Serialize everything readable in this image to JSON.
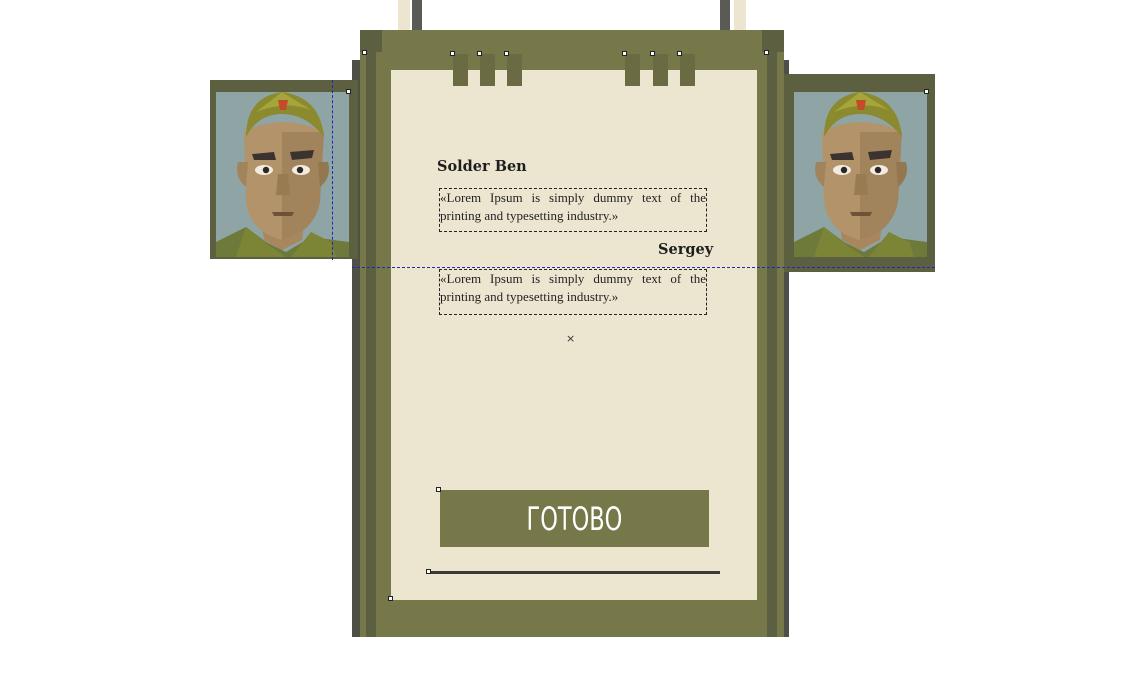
{
  "dialog": {
    "speaker1_name": "Solder Ben",
    "speaker1_text": "«Lorem Ipsum is simply dummy text of the printing and typesetting industry.»",
    "speaker2_name": "Sergey",
    "speaker2_text": "«Lorem Ipsum is simply dummy text of the printing and typesetting industry.»",
    "close_symbol": "×",
    "done_label": "ГОТОВО"
  },
  "colors": {
    "panel": "#76784a",
    "paper": "#ece6d1",
    "frame": "#5d6040",
    "text": "#1e1e1e"
  }
}
